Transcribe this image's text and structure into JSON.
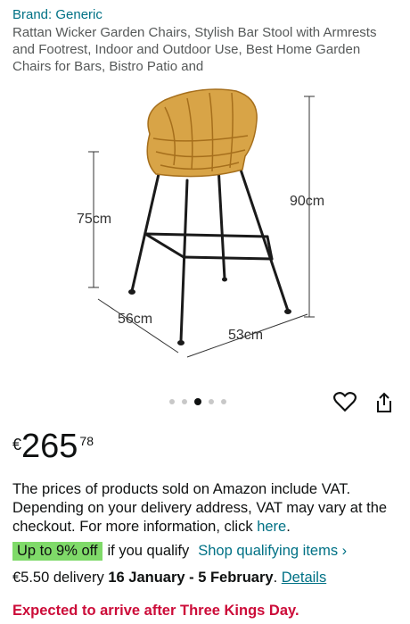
{
  "brand": "Brand: Generic",
  "title": "Rattan Wicker Garden Chairs, Stylish Bar Stool with Armrests and Footrest, Indoor and Outdoor Use, Best Home Garden Chairs for Bars, Bistro Patio and",
  "image": {
    "dims": {
      "seat_height": "75cm",
      "total_height": "90cm",
      "depth": "56cm",
      "width": "53cm"
    },
    "carousel": {
      "count": 5,
      "active": 3
    }
  },
  "actions": {
    "wishlist_icon": "heart-icon",
    "share_icon": "share-icon"
  },
  "price": {
    "currency": "€",
    "whole": "265",
    "fraction": "78"
  },
  "vat": {
    "text": "The prices of products sold on Amazon include VAT. Depending on your delivery address, VAT may vary at the checkout. For more information, click ",
    "link": "here",
    "end": "."
  },
  "deal": {
    "badge": "Up to 9% off",
    "text": "if you qualify",
    "link": "Shop qualifying items",
    "chevron": "›"
  },
  "delivery": {
    "cost": "€5.50 delivery",
    "dates": "16 January - 5 February",
    "sep": ". ",
    "details": "Details"
  },
  "arrival": "Expected to arrive after Three Kings Day.",
  "colors": {
    "link": "#007185",
    "badge": "#7fda69",
    "alert": "#cc0c39",
    "rattan": "#d8a447"
  }
}
